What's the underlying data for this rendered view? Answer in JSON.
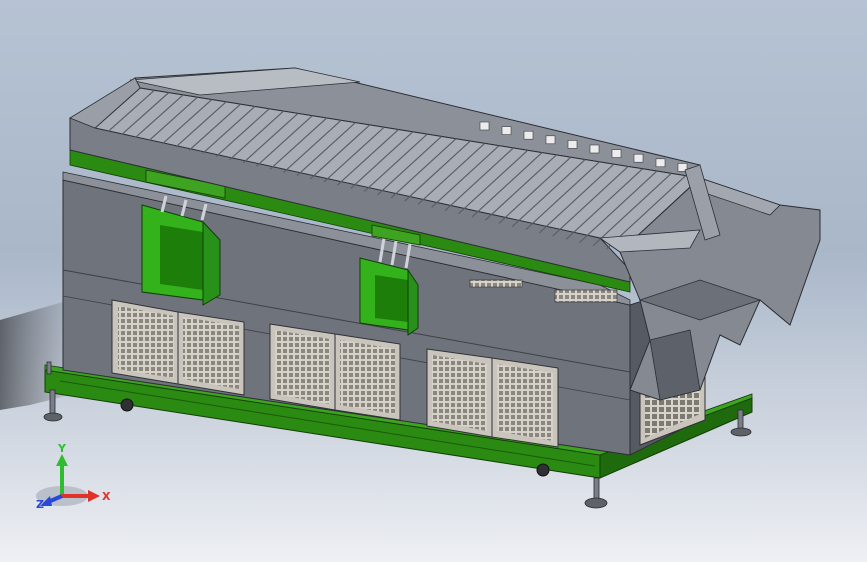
{
  "view": {
    "triad": {
      "x_label": "X",
      "y_label": "Y",
      "z_label": "Z"
    },
    "colors": {
      "body": "#6f737b",
      "body_light": "#8c9099",
      "body_dark": "#555961",
      "frame": "#2b8a12",
      "frame_dark": "#1f6a0c",
      "chute": "#34b21c",
      "mesh": "#c9c5bc",
      "deck": "#a9adb5"
    },
    "components": {
      "deck_slats": 40,
      "front_panels": 6,
      "green_chutes": 2,
      "leveling_feet": 4,
      "casters": 2
    }
  }
}
